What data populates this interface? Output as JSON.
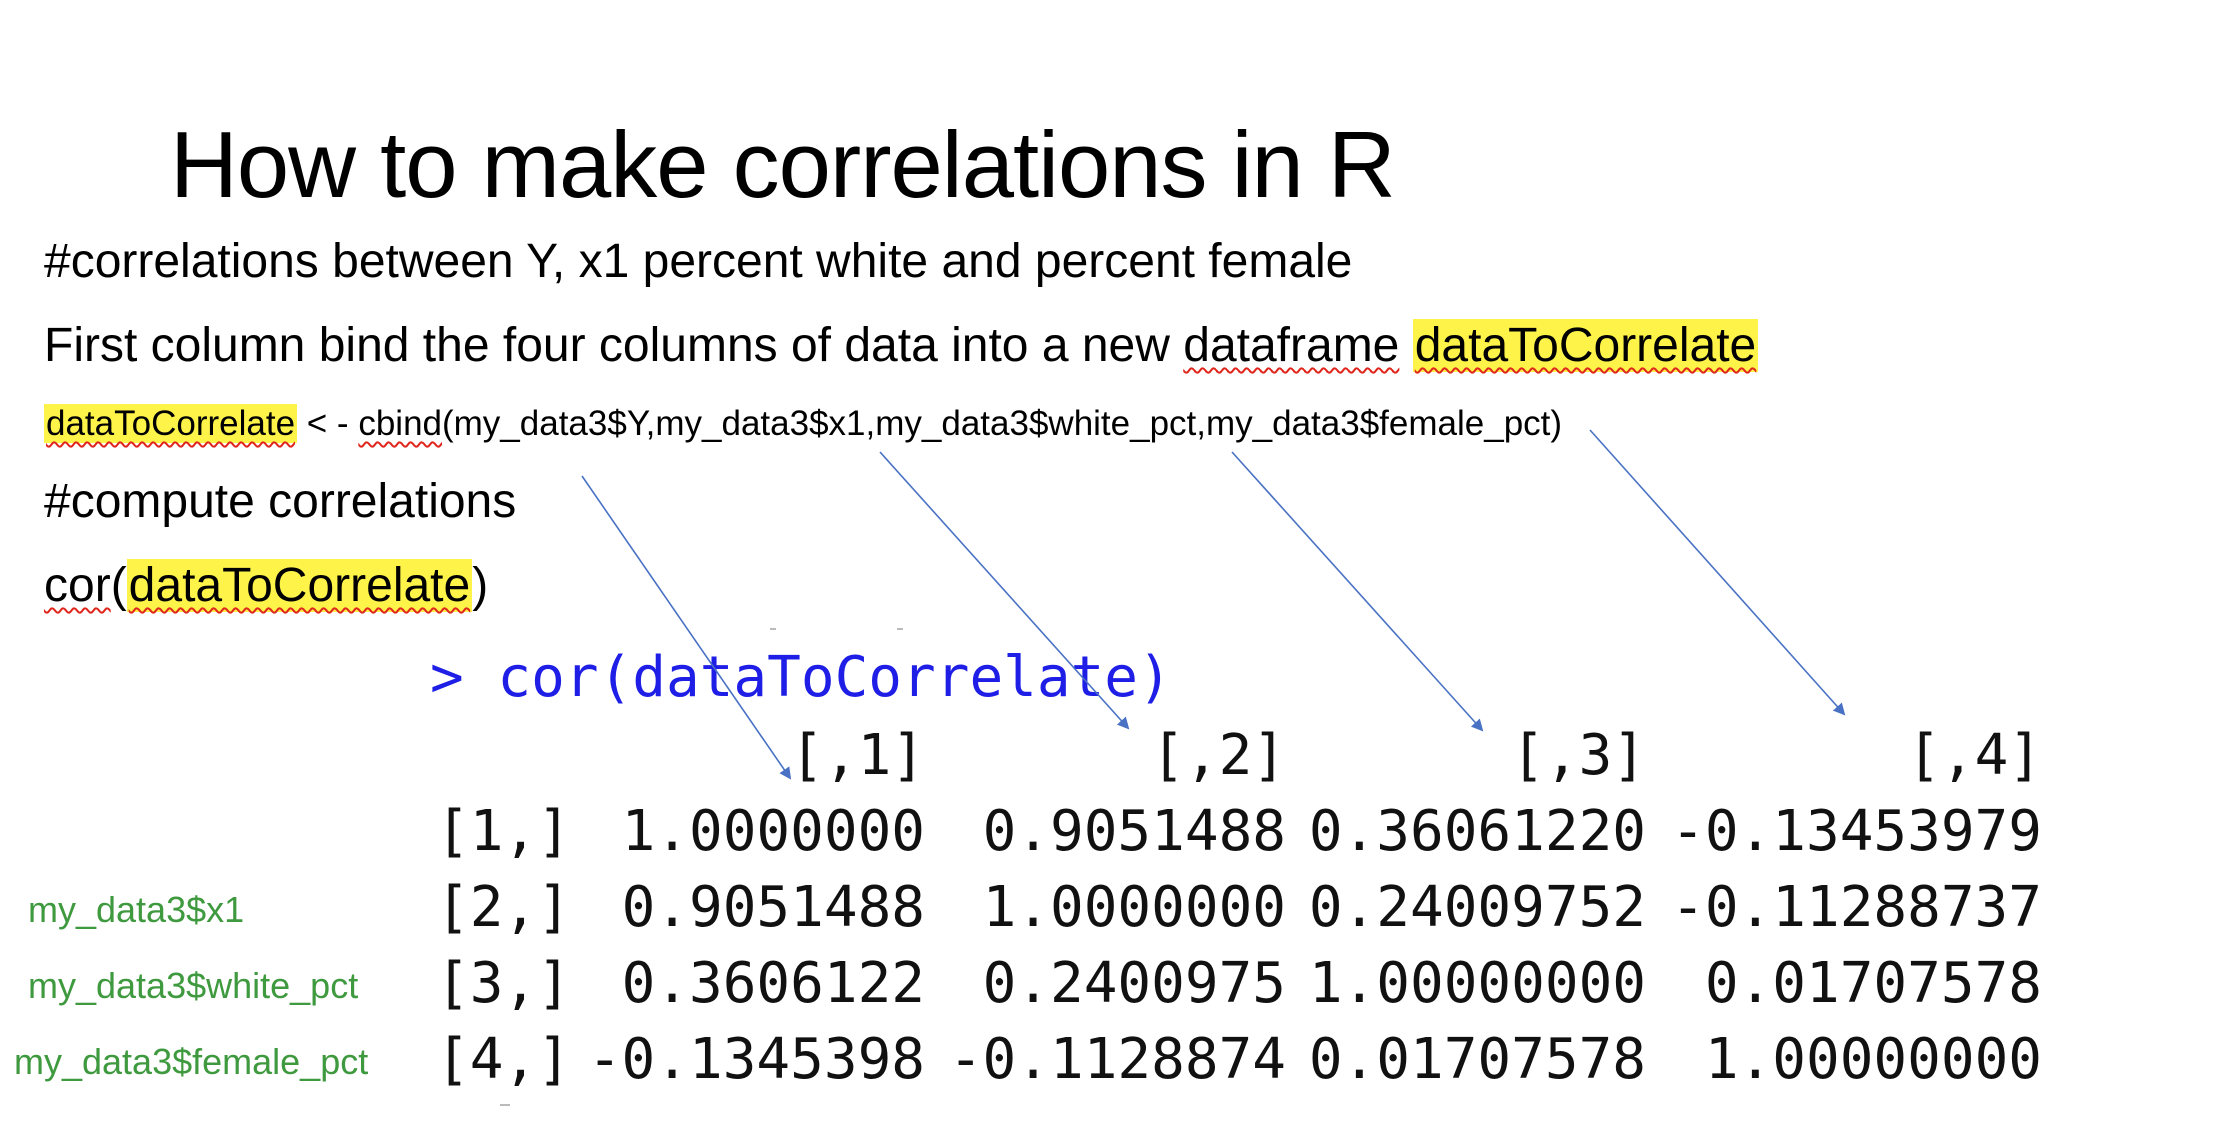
{
  "title": "How to make correlations in R",
  "lines": {
    "comment1": "#correlations between Y, x1 percent white and percent female",
    "line2_prefix": "First column bind the four columns of data into a new ",
    "line2_word": "dataframe",
    "line2_highlight": "dataToCorrelate",
    "code_var": "dataToCorrelate",
    "code_assign": " < - ",
    "code_func": "cbind",
    "code_args": "(my_data3$Y,my_data3$x1,my_data3$white_pct,my_data3$female_pct)",
    "comment2": "#compute correlations",
    "cor_func": "cor",
    "cor_open": "(",
    "cor_arg": "dataToCorrelate",
    "cor_close": ")"
  },
  "console": {
    "prompt": "> cor(dataToCorrelate)",
    "column_headers": [
      "[,1]",
      "[,2]",
      "[,3]",
      "[,4]"
    ],
    "rows": [
      {
        "label": "[1,]",
        "values": [
          "1.0000000",
          "0.9051488",
          "0.36061220",
          "-0.13453979"
        ]
      },
      {
        "label": "[2,]",
        "values": [
          "0.9051488",
          "1.0000000",
          "0.24009752",
          "-0.11288737"
        ]
      },
      {
        "label": "[3,]",
        "values": [
          "0.3606122",
          "0.2400975",
          "1.00000000",
          "0.01707578"
        ]
      },
      {
        "label": "[4,]",
        "values": [
          "-0.1345398",
          "-0.1128874",
          "0.01707578",
          "1.00000000"
        ]
      }
    ]
  },
  "row_annotations": [
    "my_data3$x1",
    "my_data3$white_pct",
    "my_data3$female_pct"
  ],
  "colors": {
    "highlight": "#fdf349",
    "spellcheck": "#e0261c",
    "prompt": "#1e1ee6",
    "annotation": "#3f9a3f",
    "arrow": "#4a72c4"
  }
}
